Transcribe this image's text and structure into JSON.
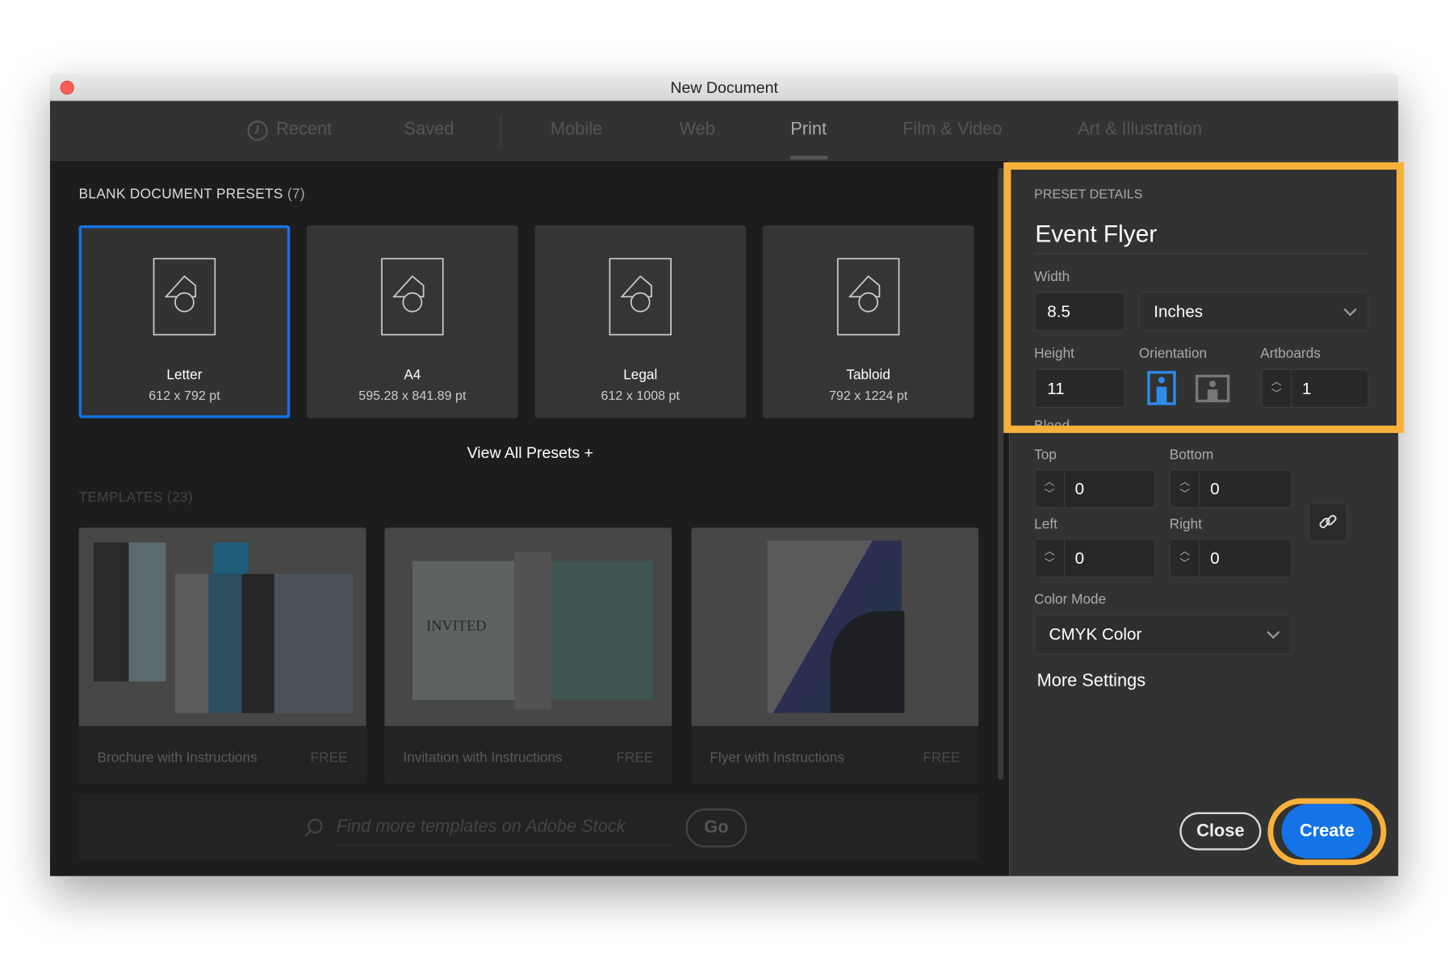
{
  "window": {
    "title": "New Document"
  },
  "tabs": [
    {
      "label": "Recent",
      "icon": "clock-icon"
    },
    {
      "label": "Saved"
    },
    {
      "label": "Mobile"
    },
    {
      "label": "Web"
    },
    {
      "label": "Print",
      "active": true
    },
    {
      "label": "Film & Video"
    },
    {
      "label": "Art & Illustration"
    }
  ],
  "presets": {
    "heading": "BLANK DOCUMENT PRESETS",
    "count": "(7)",
    "items": [
      {
        "name": "Letter",
        "size": "612 x 792 pt",
        "selected": true
      },
      {
        "name": "A4",
        "size": "595.28 x 841.89 pt"
      },
      {
        "name": "Legal",
        "size": "612 x 1008 pt"
      },
      {
        "name": "Tabloid",
        "size": "792 x 1224 pt"
      }
    ],
    "view_all": "View All Presets +"
  },
  "templates": {
    "heading": "TEMPLATES",
    "count": "(23)",
    "items": [
      {
        "name": "Brochure with Instructions",
        "price": "FREE"
      },
      {
        "name": "Invitation with Instructions",
        "price": "FREE"
      },
      {
        "name": "Flyer with Instructions",
        "price": "FREE"
      }
    ],
    "search_placeholder": "Find more templates on Adobe Stock",
    "go": "Go"
  },
  "details": {
    "heading": "PRESET DETAILS",
    "name": "Event Flyer",
    "width_label": "Width",
    "width": "8.5",
    "units": "Inches",
    "height_label": "Height",
    "height": "11",
    "orientation_label": "Orientation",
    "artboards_label": "Artboards",
    "artboards": "1",
    "bleed_label": "Bleed",
    "top_label": "Top",
    "top": "0",
    "bottom_label": "Bottom",
    "bottom": "0",
    "left_label": "Left",
    "left": "0",
    "right_label": "Right",
    "right": "0",
    "color_mode_label": "Color Mode",
    "color_mode": "CMYK Color",
    "more_settings": "More Settings"
  },
  "buttons": {
    "close": "Close",
    "create": "Create"
  },
  "colors": {
    "accent": "#1473e6",
    "highlight": "#f7b13b"
  }
}
